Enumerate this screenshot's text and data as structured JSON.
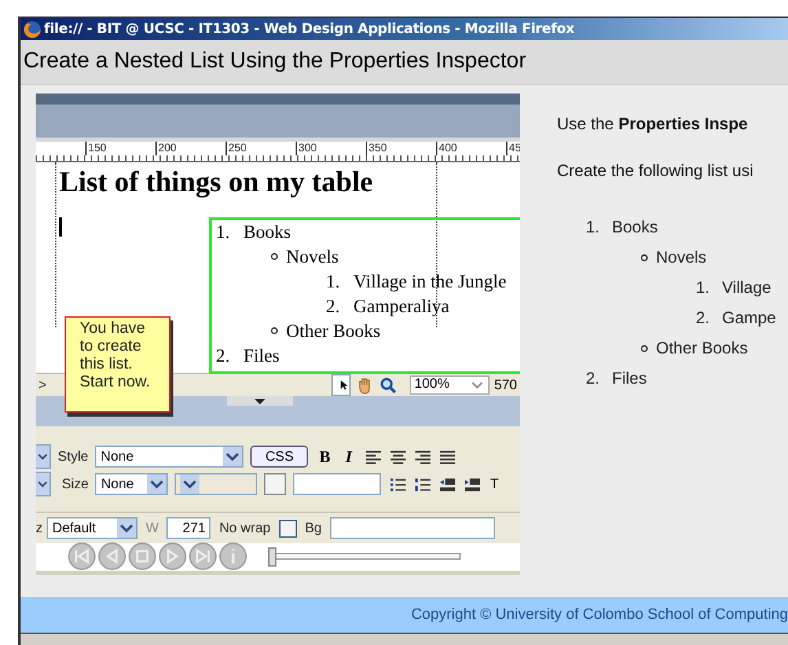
{
  "window": {
    "title": "file:// - BIT @ UCSC - IT1303 - Web Design Applications - Mozilla Firefox"
  },
  "page_title": "Create a Nested List Using the Properties Inspector",
  "editor": {
    "ruler_labels": [
      "150",
      "200",
      "250",
      "300",
      "350",
      "400",
      "45"
    ],
    "heading": "List of things on my table",
    "list": [
      {
        "kind": "numbered",
        "marker": "1.",
        "text": "Books",
        "children": [
          {
            "kind": "bulleted",
            "text": "Novels",
            "children": [
              {
                "kind": "numbered",
                "marker": "1.",
                "text": "Village in the Jungle"
              },
              {
                "kind": "numbered",
                "marker": "2.",
                "text": "Gamperaliya"
              }
            ]
          },
          {
            "kind": "bulleted",
            "text": "Other Books"
          }
        ]
      },
      {
        "kind": "numbered",
        "marker": "2.",
        "text": "Files"
      }
    ],
    "tooltip": "You have to create this list. Start now.",
    "tag_selector": ">",
    "zoom": "100%",
    "width_reading": "570",
    "properties": {
      "style_label": "Style",
      "style_value": "None",
      "css_button": "CSS",
      "bold": "B",
      "italic": "I",
      "size_label": "Size",
      "size_value": "None",
      "cut_letter": "T"
    },
    "cell": {
      "horz_cut": "z",
      "horz_value": "Default",
      "w_label": "W",
      "w_value": "271",
      "nowrap_label": "No wrap",
      "nowrap_checked": false,
      "bg_label": "Bg"
    },
    "player": {
      "level": 0
    }
  },
  "instructions": [
    "Use the **Properties Inspe**",
    "Create the following list usi"
  ],
  "sample_list": [
    {
      "kind": "numbered",
      "marker": "1.",
      "text": "Books",
      "children": [
        {
          "kind": "bulleted",
          "text": "Novels",
          "children": [
            {
              "kind": "numbered",
              "marker": "1.",
              "text": "Village"
            },
            {
              "kind": "numbered",
              "marker": "2.",
              "text": "Gampe"
            }
          ]
        },
        {
          "kind": "bulleted",
          "text": "Other Books"
        }
      ]
    },
    {
      "kind": "numbered",
      "marker": "2.",
      "text": "Files"
    }
  ],
  "footer": "Copyright © University of Colombo School of Computing"
}
